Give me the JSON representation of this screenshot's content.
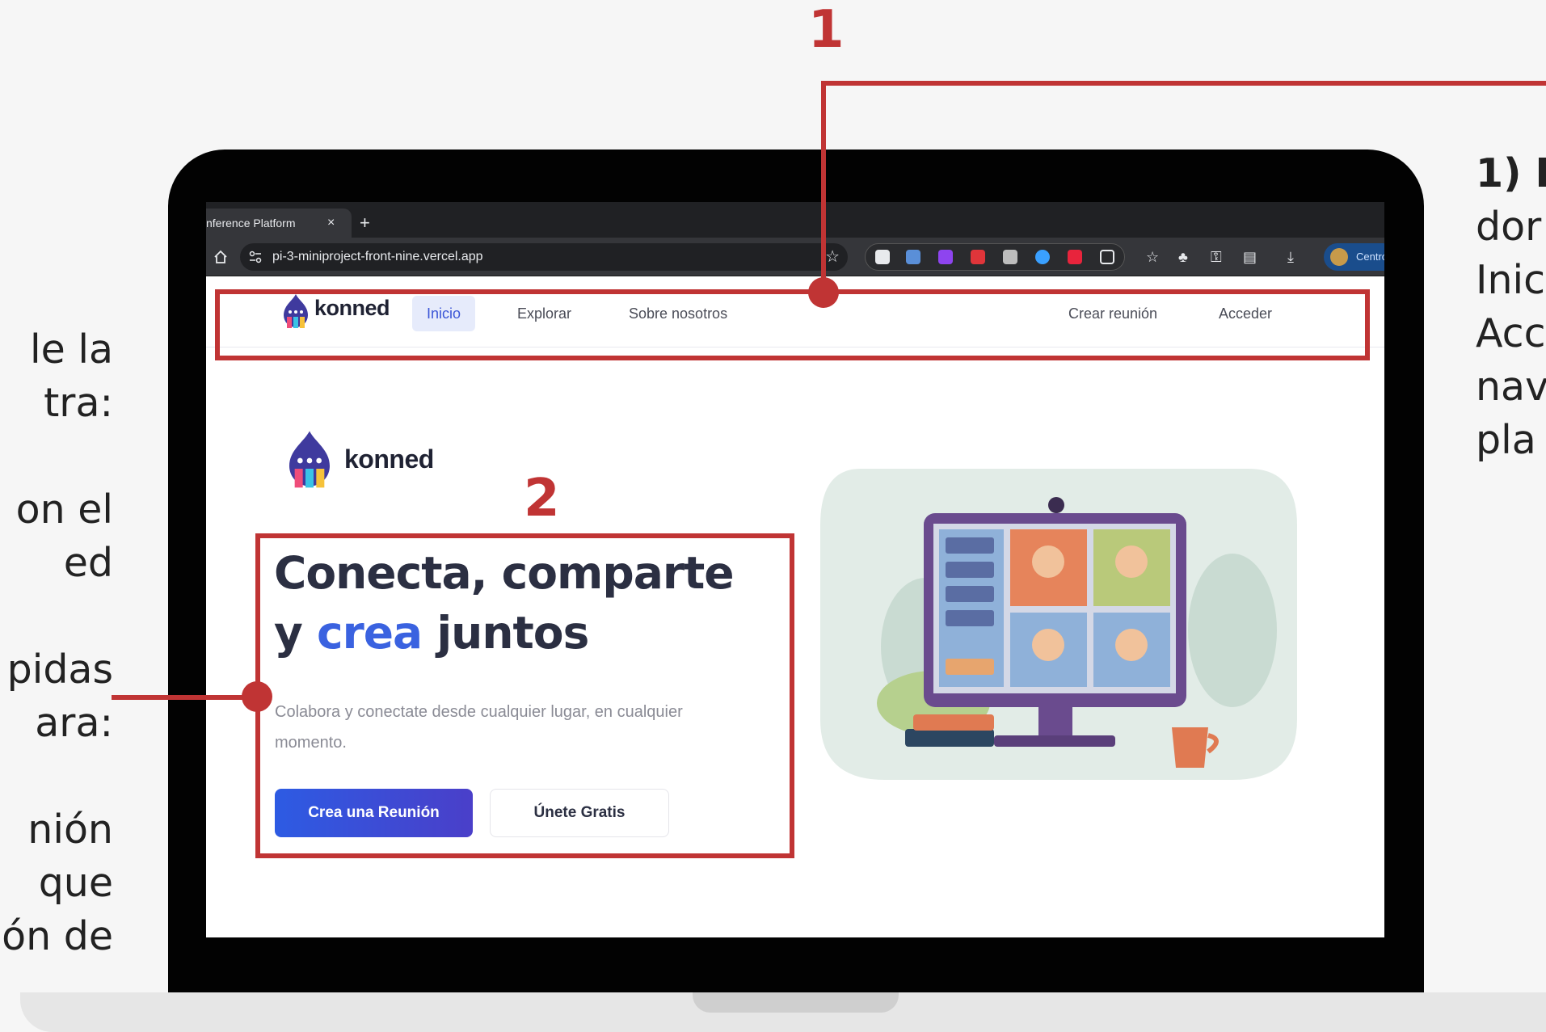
{
  "slide": {
    "callout_1": "1",
    "callout_2": "2",
    "left_fragments": [
      "le  la",
      "tra:",
      "",
      "on   el",
      "ed",
      "",
      "pidas",
      "ara:",
      "",
      "nión",
      "que",
      "ón de"
    ],
    "right_fragments": [
      "1) E",
      "dor",
      "Inic",
      "Acc",
      "nav",
      "pla"
    ]
  },
  "browser": {
    "tab_title": "nference Platform",
    "tab_close": "×",
    "new_tab": "+",
    "url": "pi-3-miniproject-front-nine.vercel.app",
    "bookmark_star": "☆",
    "profile_label": "Centro"
  },
  "site": {
    "brand": "konned",
    "nav": {
      "inicio": "Inicio",
      "explorar": "Explorar",
      "sobre": "Sobre nosotros",
      "crear": "Crear reunión",
      "acceder": "Acceder"
    },
    "hero": {
      "logo_text": "konned",
      "headline_1": "Conecta, comparte",
      "headline_y": "y",
      "headline_accent": "crea",
      "headline_end": "juntos",
      "subtitle": "Colabora y conectate desde cualquier lugar, en cualquier momento.",
      "primary_button": "Crea una Reunión",
      "secondary_button": "Únete Gratis"
    }
  },
  "colors": {
    "annotation_red": "#c03434",
    "accent_blue": "#3a62e0",
    "headline_dark": "#2b2f42"
  }
}
